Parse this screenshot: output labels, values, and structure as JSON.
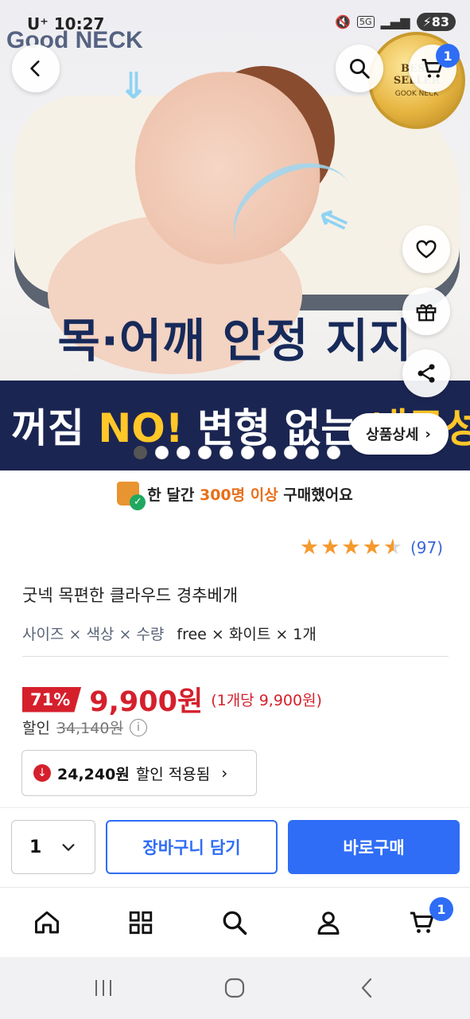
{
  "status_bar": {
    "carrier": "U⁺",
    "time": "10:27",
    "network": "5G",
    "battery": "83"
  },
  "hero": {
    "watermark": "Good NECK",
    "best_badge_main": "BEST SELLER",
    "best_badge_sub": "GOOK NECK",
    "headline": "목·어깨 안정 지지",
    "band_prefix": "꺼짐 ",
    "band_highlight": "NO!",
    "band_suffix": " 변형 없는 ",
    "band_tail": "내구성",
    "detail_button": "상품상세",
    "slide_count": 10,
    "active_slide": 0,
    "cart_count": "1"
  },
  "sold_info": {
    "prefix": "한 달간 ",
    "highlight": "300명 이상",
    "suffix": " 구매했어요"
  },
  "rating": {
    "stars": 4.5,
    "count": "(97)"
  },
  "product": {
    "title": "굿넥 목편한 클라우드 경추베개",
    "option_labels": "사이즈 × 색상 × 수량",
    "option_values": "free × 화이트 × 1개"
  },
  "price": {
    "discount_rate": "71%",
    "sale_price": "9,900원",
    "unit_price": "(1개당 9,900원)",
    "discount_label": "할인",
    "original_price": "34,140원"
  },
  "coupon": {
    "amount": "24,240원",
    "label": "할인 적용됨"
  },
  "purchase": {
    "quantity": "1",
    "add_to_cart": "장바구니 담기",
    "buy_now": "바로구매"
  },
  "bottom_nav": {
    "cart_count": "1",
    "items": [
      "home-icon",
      "category-icon",
      "search-icon",
      "my-page-icon",
      "cart-icon"
    ]
  },
  "colors": {
    "accent_blue": "#2f6df6",
    "price_red": "#d5202c",
    "highlight_orange": "#e8701a",
    "band_navy": "#1b2552"
  }
}
